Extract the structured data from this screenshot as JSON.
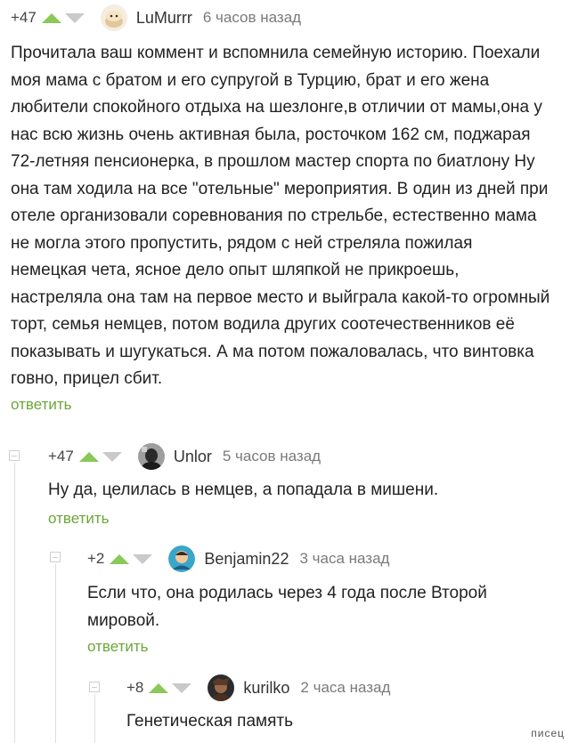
{
  "comments": [
    {
      "rating": "+47",
      "username": "LuMurrr",
      "time": "6 часов назад",
      "text": "Прочитала ваш коммент и вспомнила семейную историю. Поехали моя мама с братом и его супругой в Турцию, брат и его жена любители спокойного отдыха на шезлонге,в отличии от мамы,она у нас всю жизнь очень активная была, росточком 162 см, поджарая 72-летняя пенсионерка, в прошлом мастер спорта по биатлону Ну она там ходила на все \"отельные\" мероприятия. В один из дней при отеле организовали соревнования по стрельбе, естественно мама не могла этого пропустить, рядом с ней стреляла пожилая немецкая чета, ясное дело опыт шляпкой не прикроешь, настреляла она там на первое место и выйграла какой-то огромный торт, семья немцев, потом водила других соотечественников её показывать и шугукаться. А ма потом пожаловалась, что винтовка говно, прицел сбит.",
      "reply_label": "ответить"
    },
    {
      "rating": "+47",
      "username": "Unlor",
      "time": "5 часов назад",
      "text": "Ну да, целилась в немцев, а попадала в мишени.",
      "reply_label": "ответить"
    },
    {
      "rating": "+2",
      "username": "Benjamin22",
      "time": "3 часа назад",
      "text": "Если что, она родилась через 4 года после Второй мировой.",
      "reply_label": "ответить"
    },
    {
      "rating": "+8",
      "username": "kurilko",
      "time": "2 часа назад",
      "text": "Генетическая память",
      "reply_label": ""
    }
  ],
  "icons": {
    "upvote": "arrow-up-icon",
    "downvote": "arrow-down-icon",
    "collapse": "collapse-icon"
  },
  "colors": {
    "upvote": "#8ac858",
    "downvote": "#c9c9c9",
    "reply": "#6ca63a",
    "time": "#7a7a7a"
  },
  "watermark": "писец"
}
